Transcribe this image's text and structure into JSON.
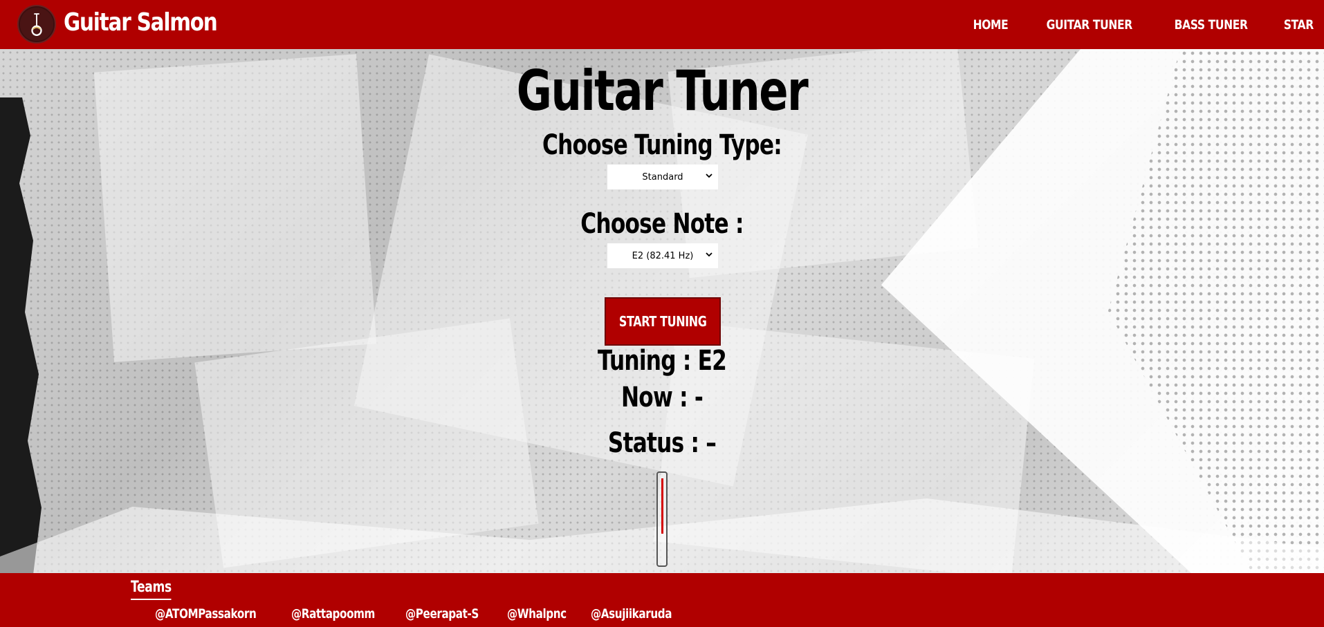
{
  "header": {
    "brand": "Guitar Salmon",
    "nav": [
      "HOME",
      "GUITAR TUNER",
      "BASS TUNER",
      "STAR"
    ]
  },
  "main": {
    "title": "Guitar Tuner",
    "tuning_type_label": "Choose Tuning Type:",
    "tuning_type_value": "Standard",
    "note_label": "Choose Note :",
    "note_value": "E2 (82.41 Hz)",
    "start_button": "START TUNING",
    "tuning_text": "Tuning : E2",
    "now_text": "Now : -",
    "status_text": "Status : –",
    "needle_level": 0.5
  },
  "footer": {
    "teams_title": "Teams",
    "members": [
      "@ATOMPassakorn",
      "@Rattapoomm",
      "@Peerapat-S",
      "@Whalpnc",
      "@Asujiikaruda"
    ]
  },
  "colors": {
    "accent": "#b00000",
    "needle": "#d40000"
  }
}
